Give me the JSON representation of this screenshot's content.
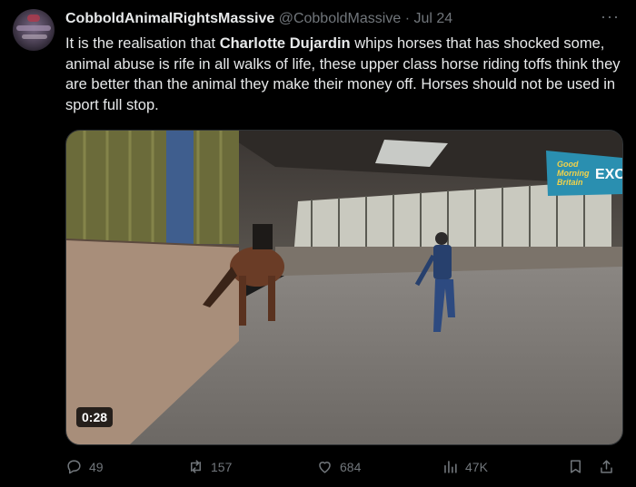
{
  "tweet": {
    "author_name": "CobboldAnimalRightsMassive",
    "author_handle": "@CobboldMassive",
    "separator": "·",
    "date": "Jul 24",
    "more_label": "···",
    "text_part1": "It is the realisation that ",
    "text_bold": "Charlotte Dujardin",
    "text_part2": " whips horses that has shocked some, animal abuse is rife in all walks of life, these upper class horse riding toffs think they are better than the animal they make their money off. Horses should not be used in sport full stop."
  },
  "video": {
    "duration": "0:28",
    "logo_line1": "Good",
    "logo_line2": "Morning",
    "logo_line3": "Britain",
    "banner_text": "EXC"
  },
  "actions": {
    "replies": "49",
    "reposts": "157",
    "likes": "684",
    "views": "47K"
  },
  "icons": [
    "reply-icon",
    "repost-icon",
    "like-icon",
    "views-icon",
    "bookmark-icon",
    "share-icon"
  ],
  "colors": {
    "background": "#000000",
    "text": "#e7e9ea",
    "muted": "#71767b",
    "gmb_banner": "#2a8fb0"
  }
}
